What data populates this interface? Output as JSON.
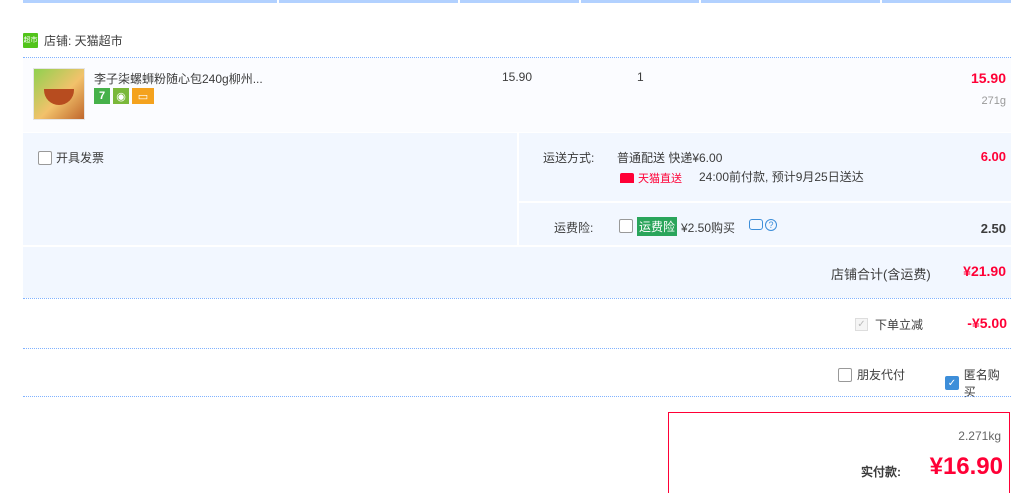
{
  "shop": {
    "label": "店铺: 天猫超市",
    "icon_text": "超市"
  },
  "item": {
    "title": "李子柒螺蛳粉随心包240g柳州...",
    "unit_price": "15.90",
    "quantity": "1",
    "total": "15.90",
    "weight": "271g",
    "badges": [
      "7",
      "",
      ""
    ]
  },
  "invoice": {
    "label": "开具发票"
  },
  "shipping": {
    "label": "运送方式:",
    "method": "普通配送 快递¥6.00",
    "carrier": "天猫直送",
    "note": "24:00前付款, 预计9月25日送达",
    "fee": "6.00"
  },
  "insurance": {
    "label": "运费险:",
    "tag": "运费险",
    "price": "¥2.50购买",
    "fee": "2.50",
    "help_icon": "?"
  },
  "shop_total": {
    "label": "店铺合计(含运费)",
    "value": "¥21.90"
  },
  "discount": {
    "label": "下单立减",
    "value": "-¥5.00"
  },
  "options": {
    "friend_pay": "朋友代付",
    "anonymous": "匿名购买"
  },
  "payment": {
    "weight": "2.271kg",
    "label": "实付款:",
    "value": "¥16.90"
  },
  "colors": {
    "accent": "#ff0036",
    "light_bg": "#f2f7ff",
    "line": "#80b2ff",
    "check": "#3d8ed9",
    "insurance": "#2aa55b"
  }
}
